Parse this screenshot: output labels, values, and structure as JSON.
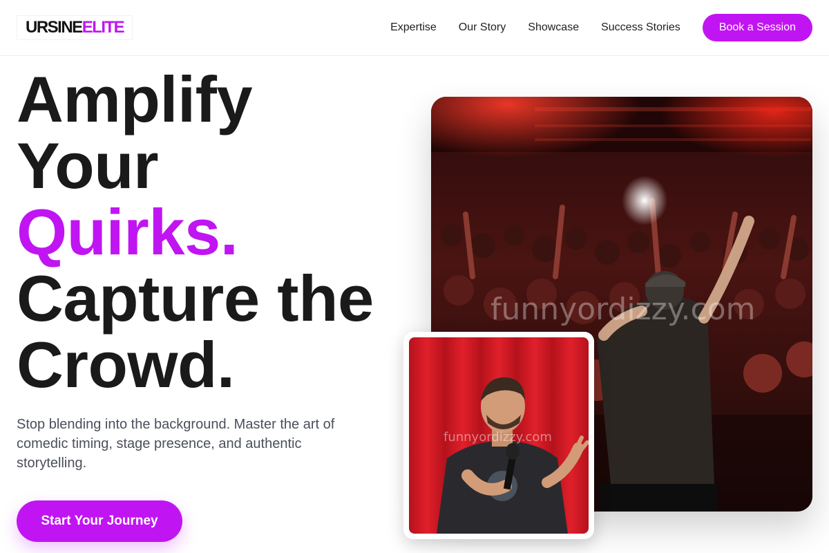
{
  "brand": {
    "logo_part1": "URSINE",
    "logo_part2": "ELITE"
  },
  "nav": {
    "items": [
      "Expertise",
      "Our Story",
      "Showcase",
      "Success Stories"
    ],
    "cta": "Book a Session"
  },
  "hero": {
    "line1": "Amplify",
    "line2": "Your",
    "line3_accent": "Quirks.",
    "line4": "Capture the",
    "line5": "Crowd.",
    "description": "Stop blending into the background. Master the art of comedic timing, stage presence, and authentic storytelling.",
    "cta": "Start Your Journey"
  },
  "images": {
    "main_watermark": "funnyordizzy.com",
    "small_watermark": "funnyordizzy.com"
  },
  "colors": {
    "accent": "#c015f2",
    "text": "#1a1a1a",
    "muted": "#4a4f5a"
  }
}
